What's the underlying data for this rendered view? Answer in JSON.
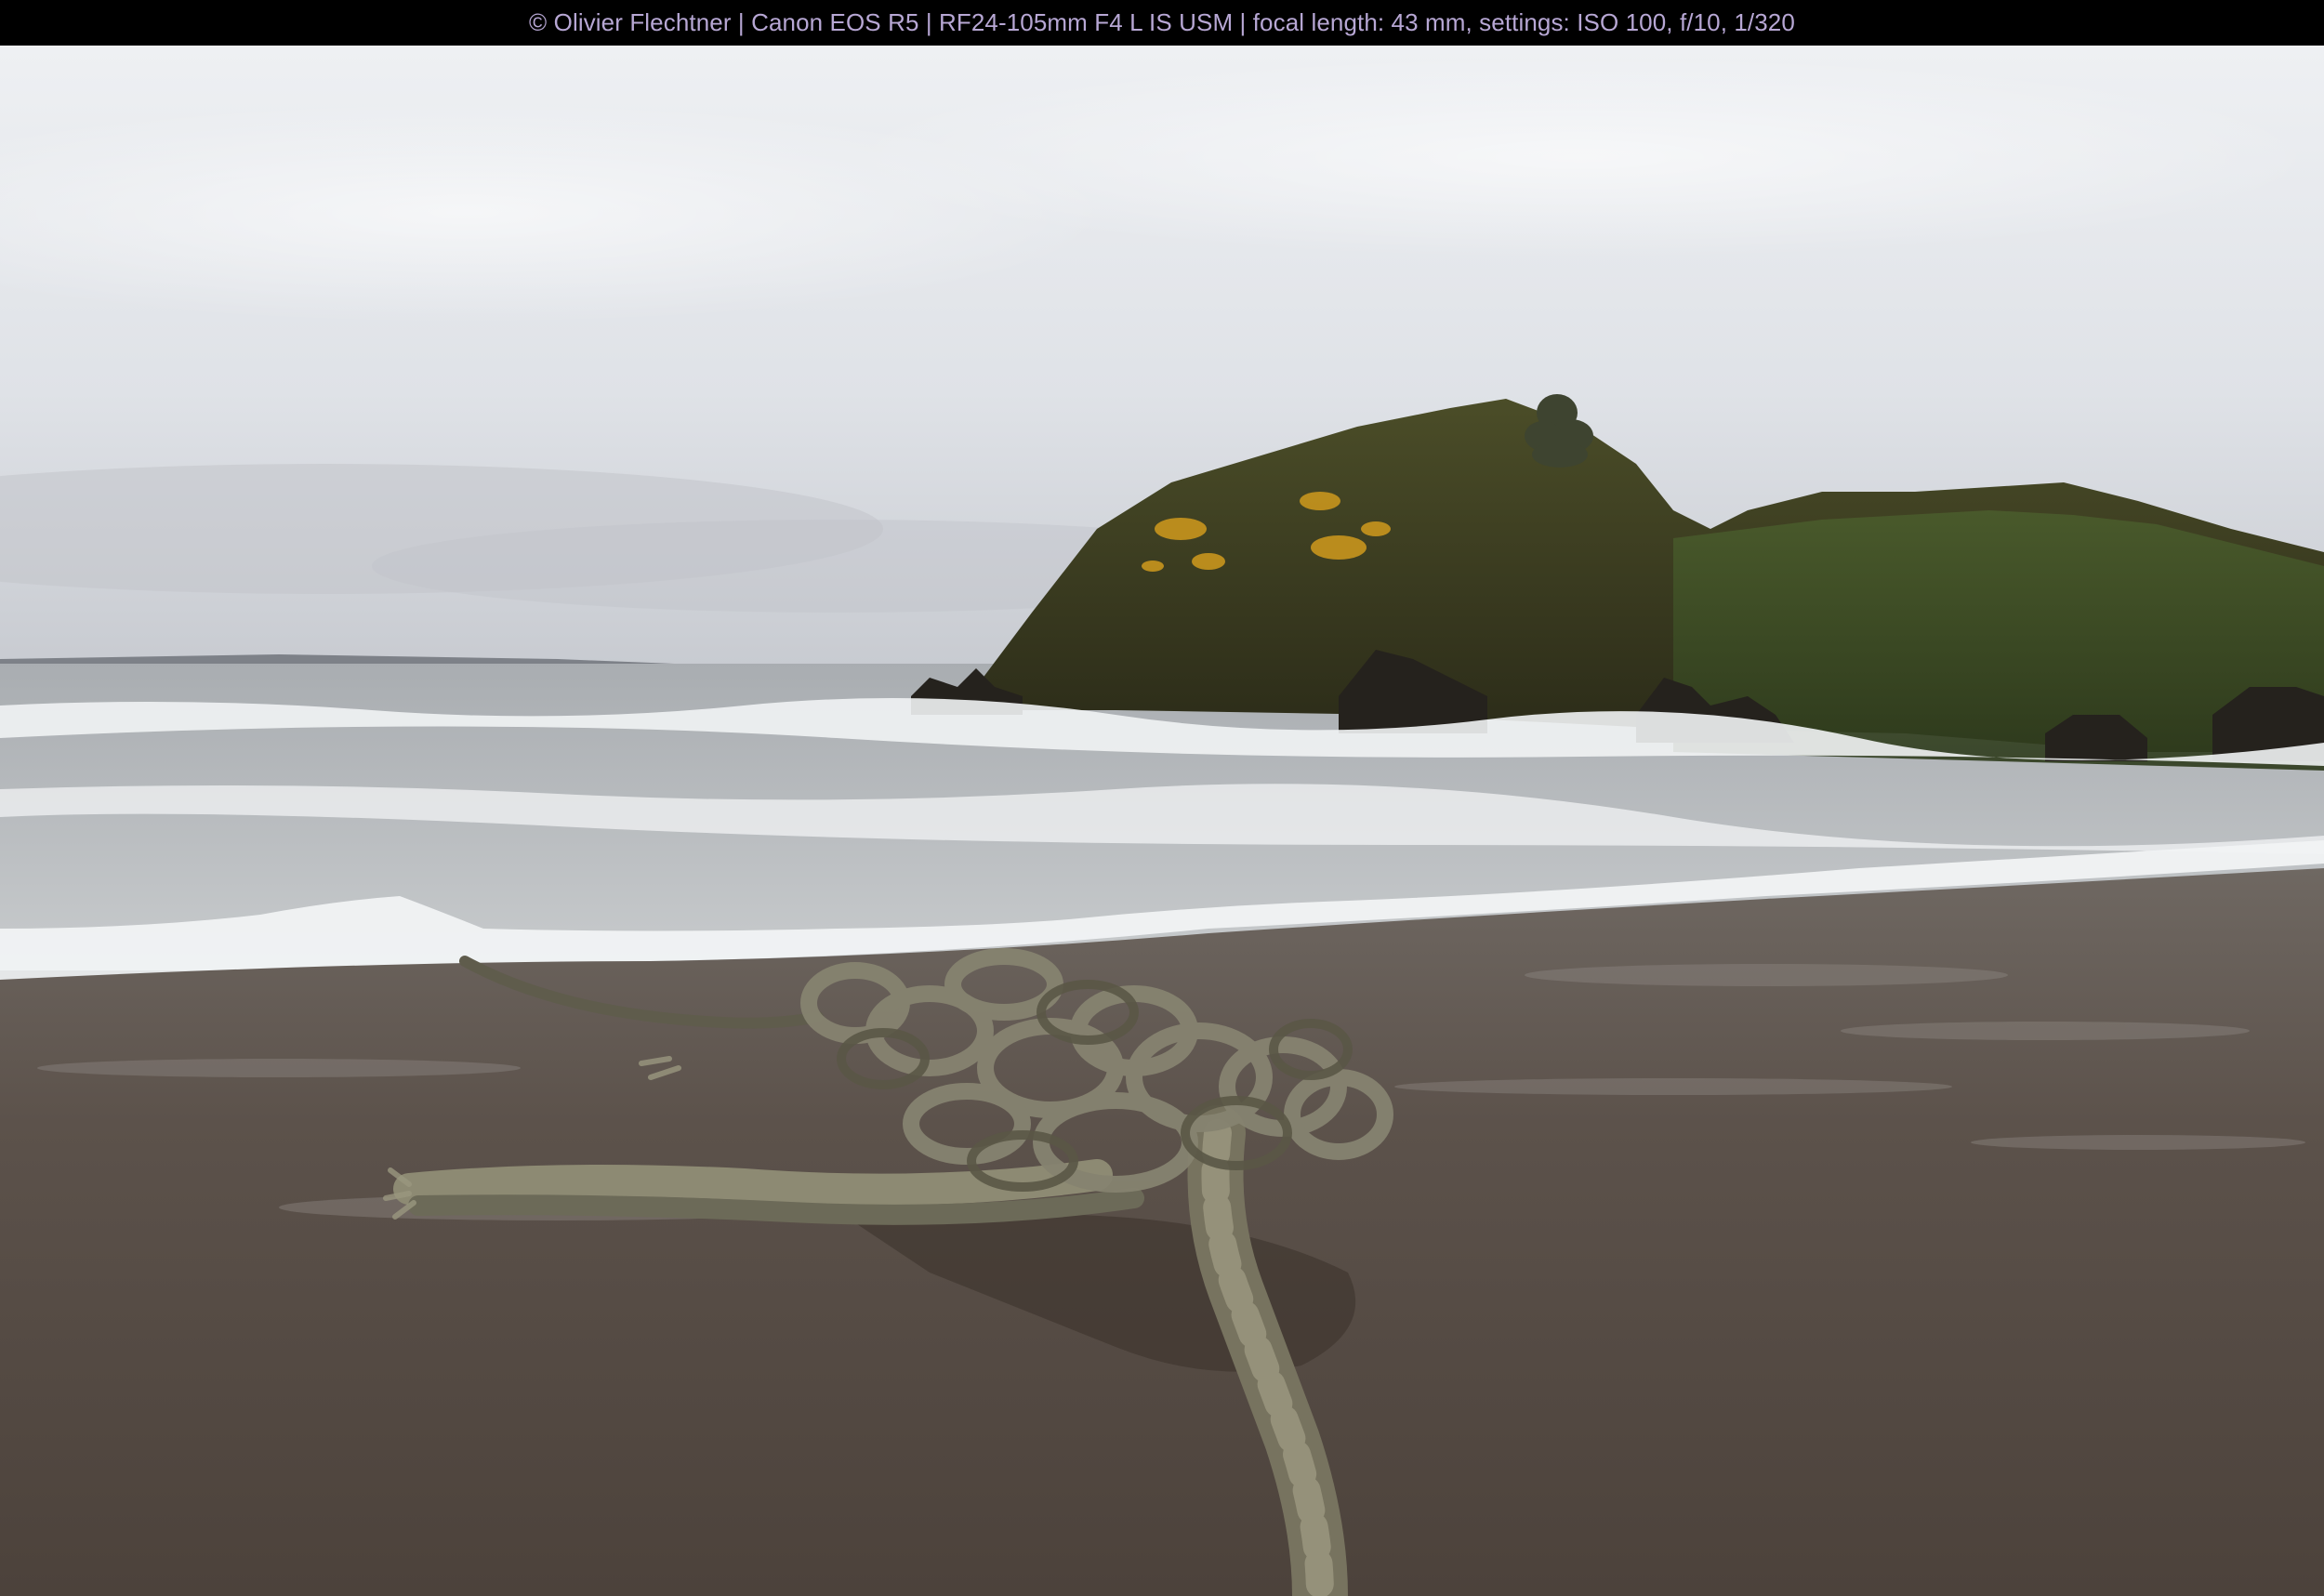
{
  "caption": {
    "text": "© Olivier Flechtner | Canon EOS R5 | RF24-105mm F4 L IS USM | focal length: 43 mm, settings: ISO 100, f/10, 1/320",
    "color": "#b7a7d4"
  },
  "colors": {
    "bar_background": "#000000",
    "sky_top": "#e9ebef",
    "sky_bottom": "#c9ccd2",
    "headland": "#3b3d20",
    "gorse": "#d49a1b",
    "surf": "#f2f4f5",
    "wet_sand": "#5b5048",
    "rope": "#8d8a73"
  }
}
